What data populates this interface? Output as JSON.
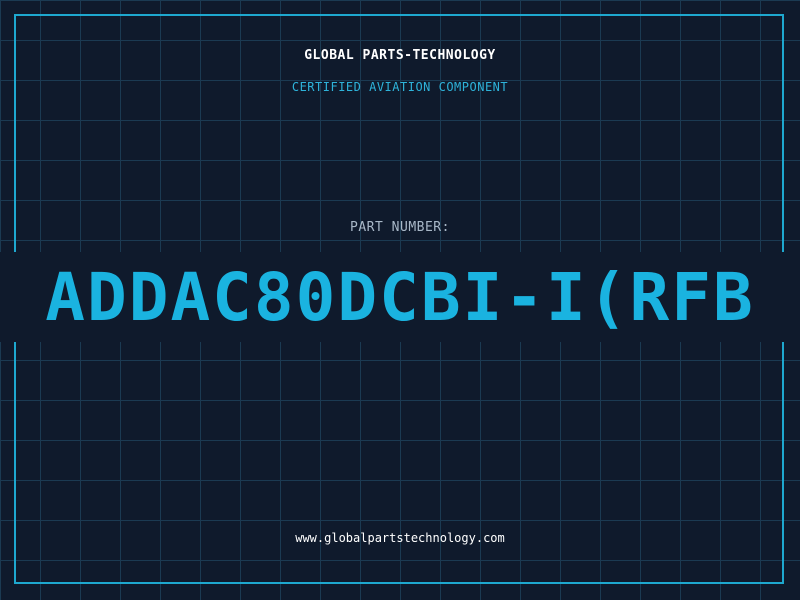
{
  "header": {
    "company": "GLOBAL PARTS-TECHNOLOGY",
    "subtitle": "CERTIFIED AVIATION COMPONENT"
  },
  "main": {
    "label": "PART NUMBER:",
    "part_number": "ADDAC80DCBI-I(RFB"
  },
  "footer": {
    "website": "www.globalpartstechnology.com"
  },
  "colors": {
    "background": "#0f1a2c",
    "grid": "#1b3a52",
    "accent": "#1ab3e0",
    "frame": "#1ea8cf"
  }
}
